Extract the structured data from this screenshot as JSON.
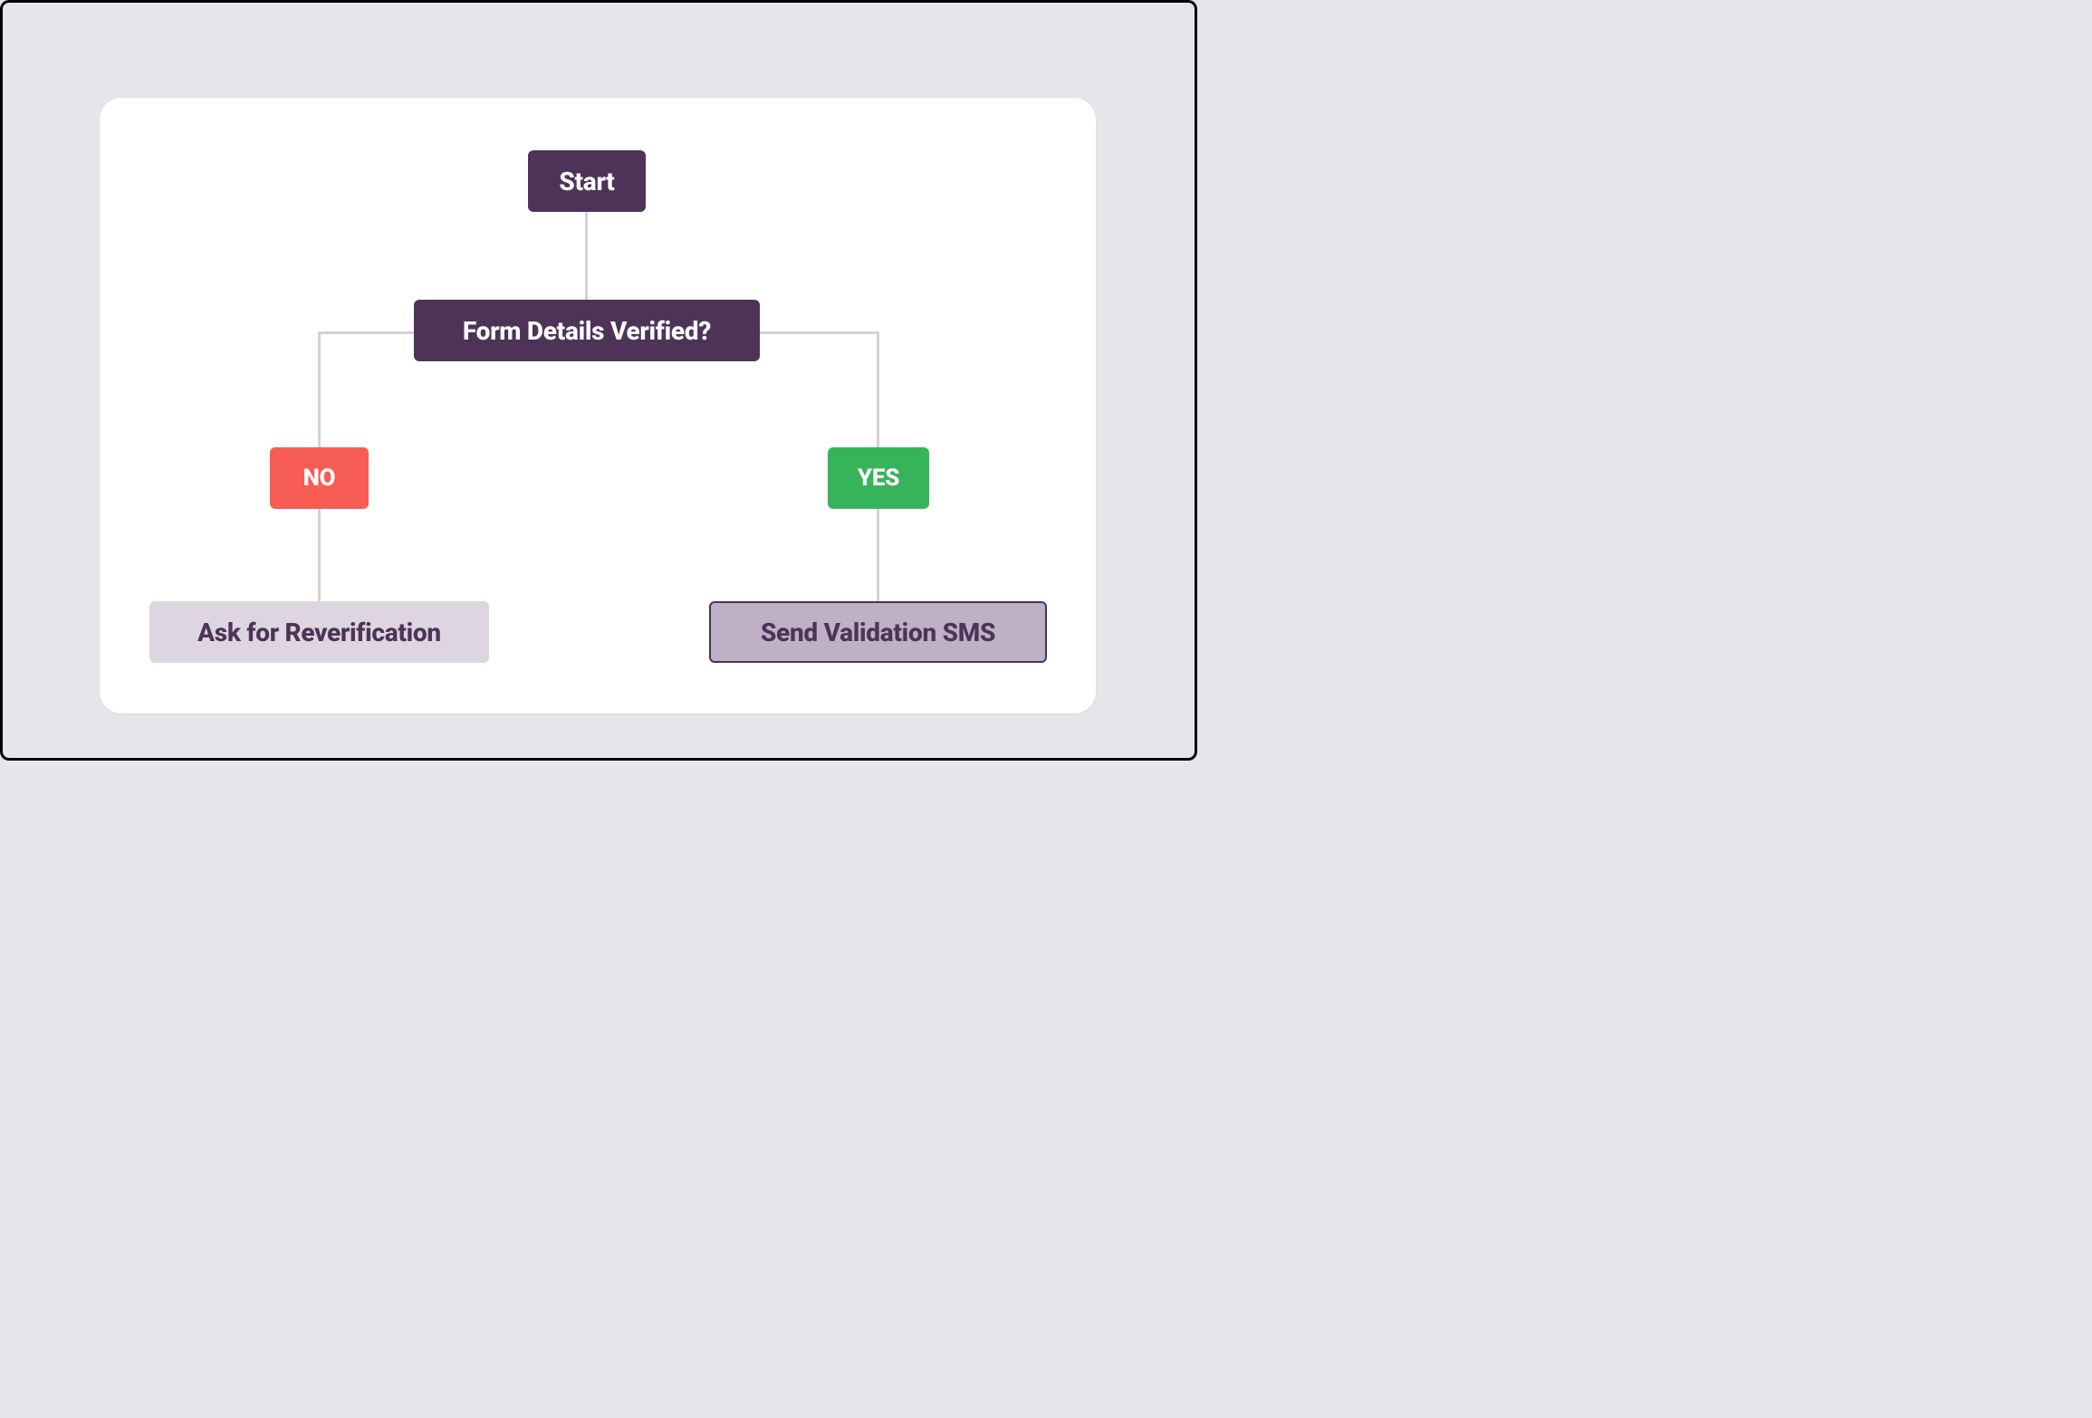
{
  "flowchart": {
    "start": "Start",
    "decision": "Form Details Verified?",
    "no": "NO",
    "yes": "YES",
    "left_end": "Ask for Reverification",
    "right_end": "Send Validation SMS"
  }
}
